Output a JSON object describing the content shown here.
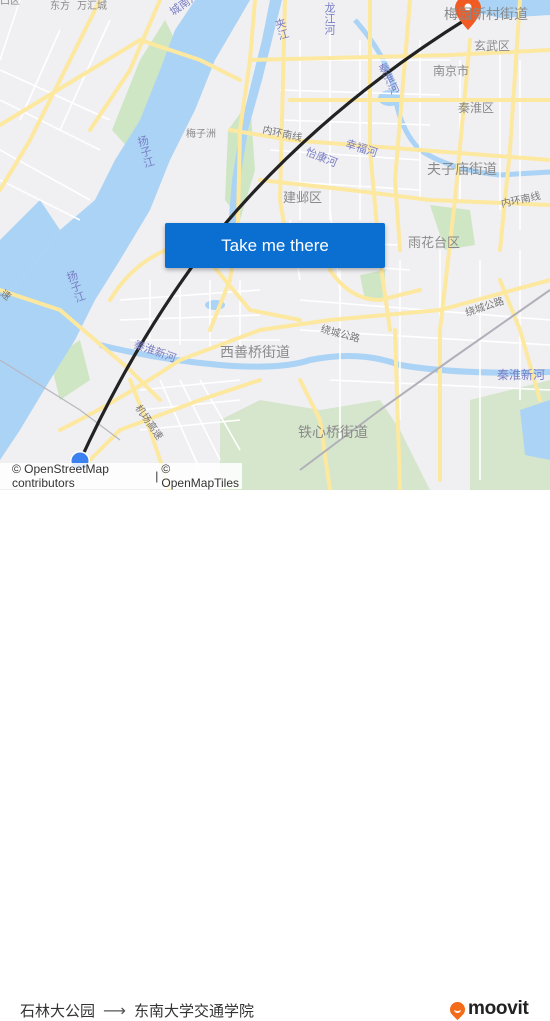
{
  "map": {
    "labels": {
      "gulou_partial": "口区",
      "dongfang": "东方",
      "wanhuicheng": "万汇城",
      "chengnan_river": "城南河",
      "jiajiang": "夹江",
      "longjiang_river": "龙江河",
      "meiyuan": "梅园新村街道",
      "xuanwu": "玄武区",
      "nanjing": "南京市",
      "qinhuai_district": "秦淮区",
      "qinhuai_river": "秦淮河",
      "yangtze_1": "扬子江",
      "yangtze_2": "扬子江",
      "meizizhou": "梅子洲",
      "inner_ring_1": "内环南线",
      "inner_ring_2": "内环南线",
      "yikang_river": "怡康河",
      "xingfu_river": "幸福河",
      "fuzimiao": "夫子庙街道",
      "jianye": "建邺区",
      "yuhuatai": "雨花台区",
      "raocheng_1": "绕城公路",
      "raocheng_2": "绕城公路",
      "qinhuai_new_1": "秦淮新河",
      "qinhuai_new_2": "秦淮新河",
      "xishanqiao": "西善桥街道",
      "tiexinqiao": "铁心桥街道",
      "expressway": "机场高速",
      "left_edge": "速"
    },
    "colors": {
      "water": "#aad3f5",
      "land": "#f0eff2",
      "park": "#cfe6c4",
      "road_major": "#fde8a0",
      "road_minor": "#ffffff",
      "route_line": "#222222",
      "destination_pin": "#f15a22",
      "origin_dot": "#3b82f0"
    }
  },
  "action_button": {
    "label": "Take me there",
    "color": "#0b6fd1"
  },
  "attribution": {
    "osm": "© OpenStreetMap contributors",
    "separator": "|",
    "omt": "© OpenMapTiles"
  },
  "trip": {
    "origin": "石林大公园",
    "arrow": "⟶",
    "destination": "东南大学交通学院"
  },
  "brand": {
    "name": "moovit",
    "color": "#f46b1a"
  }
}
